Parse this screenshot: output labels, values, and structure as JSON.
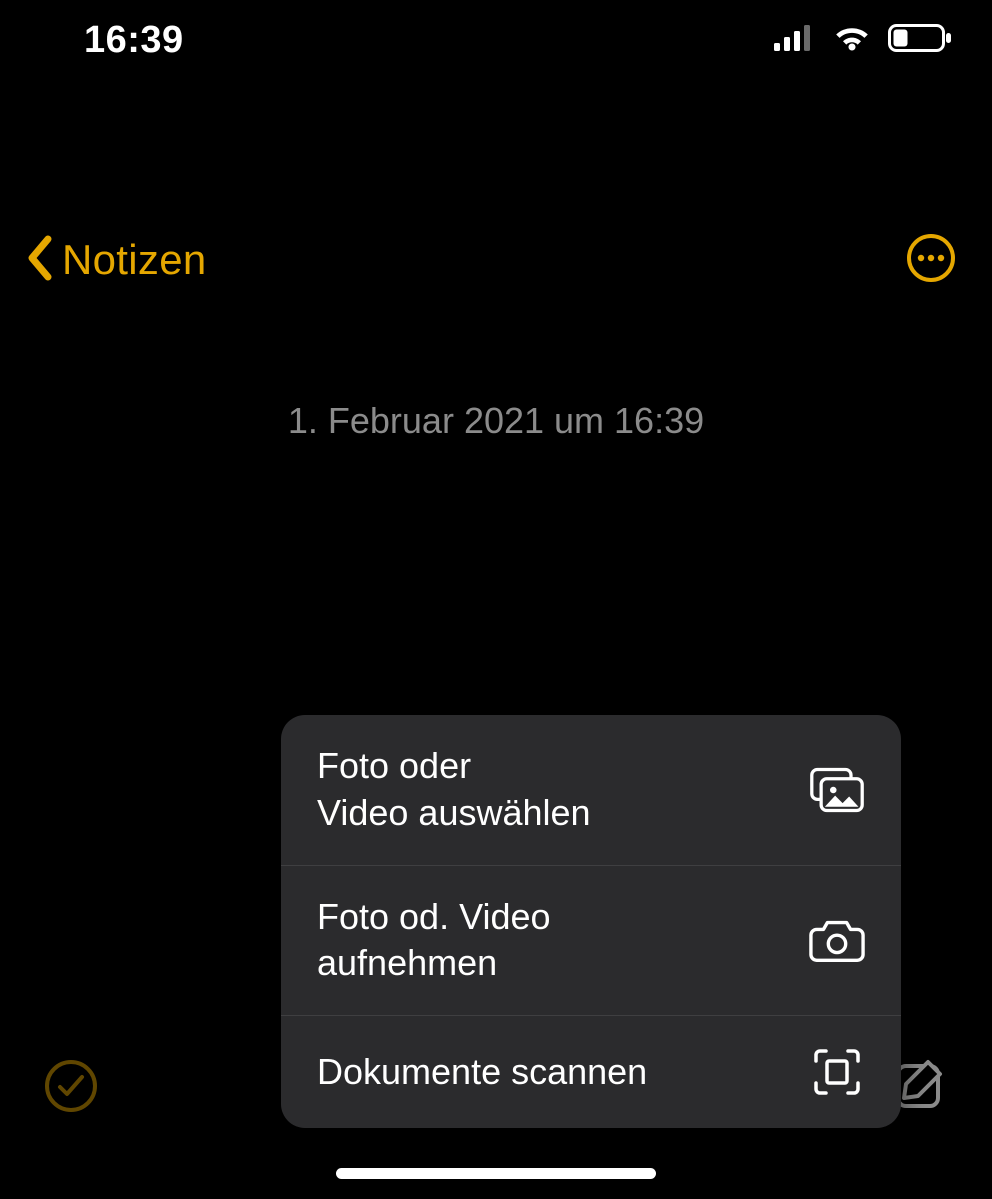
{
  "status": {
    "time": "16:39"
  },
  "nav": {
    "back_label": "Notizen"
  },
  "note": {
    "timestamp": "1. Februar 2021 um 16:39"
  },
  "menu": {
    "items": [
      {
        "label": "Foto oder\nVideo auswählen"
      },
      {
        "label": "Foto od. Video\naufnehmen"
      },
      {
        "label": "Dokumente scannen"
      }
    ]
  },
  "colors": {
    "accent": "#e5a700"
  }
}
